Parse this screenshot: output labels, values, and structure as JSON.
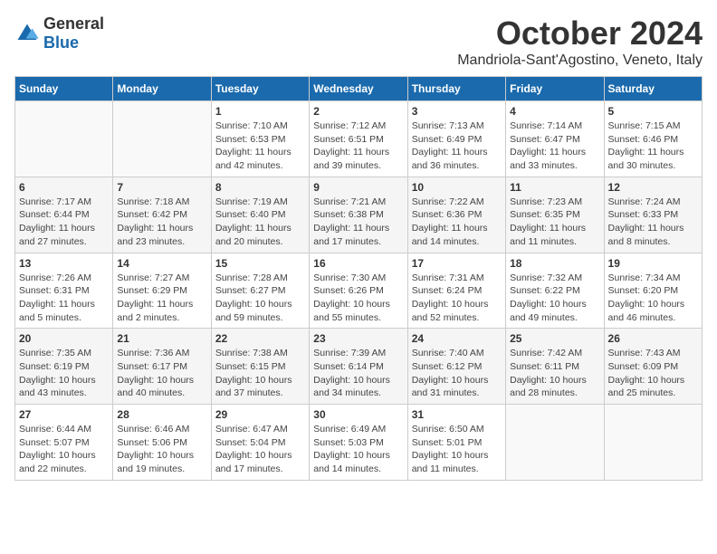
{
  "logo": {
    "general": "General",
    "blue": "Blue"
  },
  "title": {
    "month": "October 2024",
    "location": "Mandriola-Sant'Agostino, Veneto, Italy"
  },
  "weekdays": [
    "Sunday",
    "Monday",
    "Tuesday",
    "Wednesday",
    "Thursday",
    "Friday",
    "Saturday"
  ],
  "weeks": [
    [
      {
        "day": "",
        "info": ""
      },
      {
        "day": "",
        "info": ""
      },
      {
        "day": "1",
        "info": "Sunrise: 7:10 AM\nSunset: 6:53 PM\nDaylight: 11 hours and 42 minutes."
      },
      {
        "day": "2",
        "info": "Sunrise: 7:12 AM\nSunset: 6:51 PM\nDaylight: 11 hours and 39 minutes."
      },
      {
        "day": "3",
        "info": "Sunrise: 7:13 AM\nSunset: 6:49 PM\nDaylight: 11 hours and 36 minutes."
      },
      {
        "day": "4",
        "info": "Sunrise: 7:14 AM\nSunset: 6:47 PM\nDaylight: 11 hours and 33 minutes."
      },
      {
        "day": "5",
        "info": "Sunrise: 7:15 AM\nSunset: 6:46 PM\nDaylight: 11 hours and 30 minutes."
      }
    ],
    [
      {
        "day": "6",
        "info": "Sunrise: 7:17 AM\nSunset: 6:44 PM\nDaylight: 11 hours and 27 minutes."
      },
      {
        "day": "7",
        "info": "Sunrise: 7:18 AM\nSunset: 6:42 PM\nDaylight: 11 hours and 23 minutes."
      },
      {
        "day": "8",
        "info": "Sunrise: 7:19 AM\nSunset: 6:40 PM\nDaylight: 11 hours and 20 minutes."
      },
      {
        "day": "9",
        "info": "Sunrise: 7:21 AM\nSunset: 6:38 PM\nDaylight: 11 hours and 17 minutes."
      },
      {
        "day": "10",
        "info": "Sunrise: 7:22 AM\nSunset: 6:36 PM\nDaylight: 11 hours and 14 minutes."
      },
      {
        "day": "11",
        "info": "Sunrise: 7:23 AM\nSunset: 6:35 PM\nDaylight: 11 hours and 11 minutes."
      },
      {
        "day": "12",
        "info": "Sunrise: 7:24 AM\nSunset: 6:33 PM\nDaylight: 11 hours and 8 minutes."
      }
    ],
    [
      {
        "day": "13",
        "info": "Sunrise: 7:26 AM\nSunset: 6:31 PM\nDaylight: 11 hours and 5 minutes."
      },
      {
        "day": "14",
        "info": "Sunrise: 7:27 AM\nSunset: 6:29 PM\nDaylight: 11 hours and 2 minutes."
      },
      {
        "day": "15",
        "info": "Sunrise: 7:28 AM\nSunset: 6:27 PM\nDaylight: 10 hours and 59 minutes."
      },
      {
        "day": "16",
        "info": "Sunrise: 7:30 AM\nSunset: 6:26 PM\nDaylight: 10 hours and 55 minutes."
      },
      {
        "day": "17",
        "info": "Sunrise: 7:31 AM\nSunset: 6:24 PM\nDaylight: 10 hours and 52 minutes."
      },
      {
        "day": "18",
        "info": "Sunrise: 7:32 AM\nSunset: 6:22 PM\nDaylight: 10 hours and 49 minutes."
      },
      {
        "day": "19",
        "info": "Sunrise: 7:34 AM\nSunset: 6:20 PM\nDaylight: 10 hours and 46 minutes."
      }
    ],
    [
      {
        "day": "20",
        "info": "Sunrise: 7:35 AM\nSunset: 6:19 PM\nDaylight: 10 hours and 43 minutes."
      },
      {
        "day": "21",
        "info": "Sunrise: 7:36 AM\nSunset: 6:17 PM\nDaylight: 10 hours and 40 minutes."
      },
      {
        "day": "22",
        "info": "Sunrise: 7:38 AM\nSunset: 6:15 PM\nDaylight: 10 hours and 37 minutes."
      },
      {
        "day": "23",
        "info": "Sunrise: 7:39 AM\nSunset: 6:14 PM\nDaylight: 10 hours and 34 minutes."
      },
      {
        "day": "24",
        "info": "Sunrise: 7:40 AM\nSunset: 6:12 PM\nDaylight: 10 hours and 31 minutes."
      },
      {
        "day": "25",
        "info": "Sunrise: 7:42 AM\nSunset: 6:11 PM\nDaylight: 10 hours and 28 minutes."
      },
      {
        "day": "26",
        "info": "Sunrise: 7:43 AM\nSunset: 6:09 PM\nDaylight: 10 hours and 25 minutes."
      }
    ],
    [
      {
        "day": "27",
        "info": "Sunrise: 6:44 AM\nSunset: 5:07 PM\nDaylight: 10 hours and 22 minutes."
      },
      {
        "day": "28",
        "info": "Sunrise: 6:46 AM\nSunset: 5:06 PM\nDaylight: 10 hours and 19 minutes."
      },
      {
        "day": "29",
        "info": "Sunrise: 6:47 AM\nSunset: 5:04 PM\nDaylight: 10 hours and 17 minutes."
      },
      {
        "day": "30",
        "info": "Sunrise: 6:49 AM\nSunset: 5:03 PM\nDaylight: 10 hours and 14 minutes."
      },
      {
        "day": "31",
        "info": "Sunrise: 6:50 AM\nSunset: 5:01 PM\nDaylight: 10 hours and 11 minutes."
      },
      {
        "day": "",
        "info": ""
      },
      {
        "day": "",
        "info": ""
      }
    ]
  ]
}
